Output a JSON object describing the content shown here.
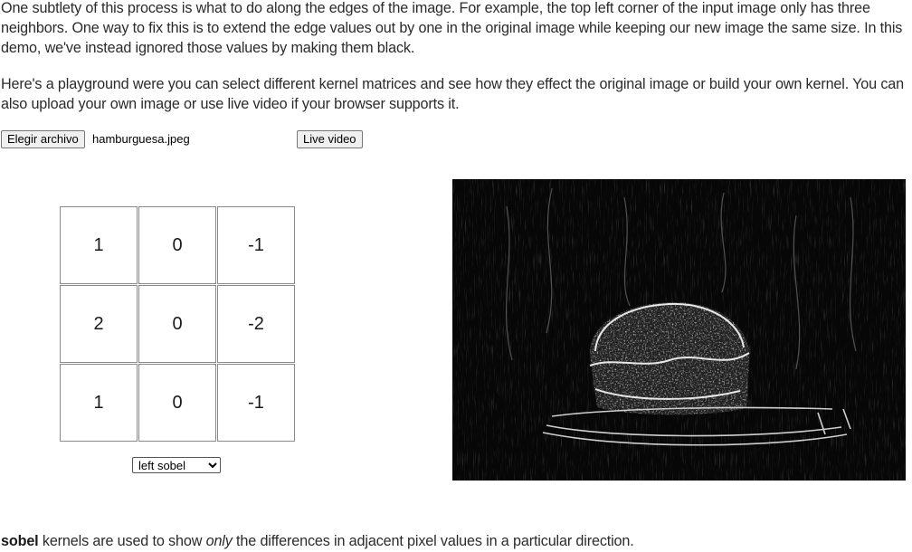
{
  "intro": {
    "paragraph1": "One subtlety of this process is what to do along the edges of the image. For example, the top left corner of the input image only has three neighbors. One way to fix this is to extend the edge values out by one in the original image while keeping our new image the same size. In this demo, we've instead ignored those values by making them black.",
    "paragraph2": "Here's a playground were you can select different kernel matrices and see how they effect the original image or build your own kernel. You can also upload your own image or use live video if your browser supports it."
  },
  "controls": {
    "file_button_label": "Elegir archivo",
    "file_name": "hamburguesa.jpeg",
    "live_video_label": "Live video"
  },
  "kernel": {
    "cells": [
      "1",
      "0",
      "-1",
      "2",
      "0",
      "-2",
      "1",
      "0",
      "-1"
    ],
    "selected": "left sobel"
  },
  "caption": {
    "term": "sobel",
    "part1": " kernels are used to show ",
    "emphasis": "only",
    "part2": " the differences in adjacent pixel values in a particular direction."
  },
  "colors": {
    "output_background": "#070707",
    "text": "#2b2b2b"
  }
}
